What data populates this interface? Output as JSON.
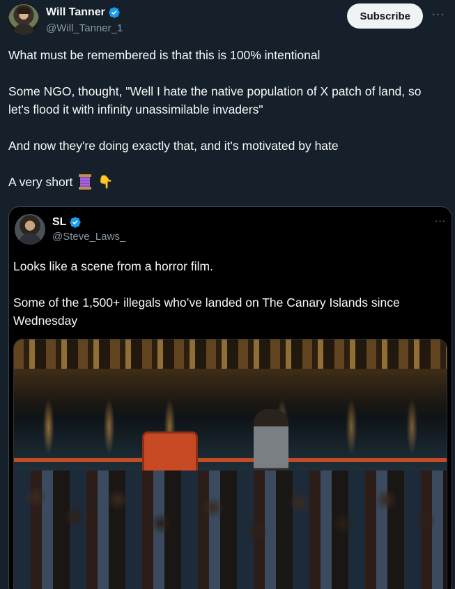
{
  "tweet": {
    "author": {
      "name": "Will Tanner",
      "handle": "@Will_Tanner_1"
    },
    "subscribe_label": "Subscribe",
    "more_label": "···",
    "paragraphs": [
      "What must be remembered is that this is 100% intentional",
      "Some NGO, thought, \"Well I hate the native population of X patch of land, so let's flood it with infinity unassimilable invaders\"",
      "And now they're doing exactly that, and it's motivated by hate"
    ],
    "last_line": "A very short",
    "emoji_point": "👇"
  },
  "quote": {
    "author": {
      "name": "SL",
      "handle": "@Steve_Laws_"
    },
    "more_label": "···",
    "paragraphs": [
      "Looks like a scene from a horror film.",
      "Some of the 1,500+ illegals who’ve landed on The Canary Islands since Wednesday"
    ]
  },
  "colors": {
    "background": "#15202b",
    "verified": "#1d9bf0",
    "secondary_text": "#8b98a5",
    "quote_border": "#38444d"
  }
}
